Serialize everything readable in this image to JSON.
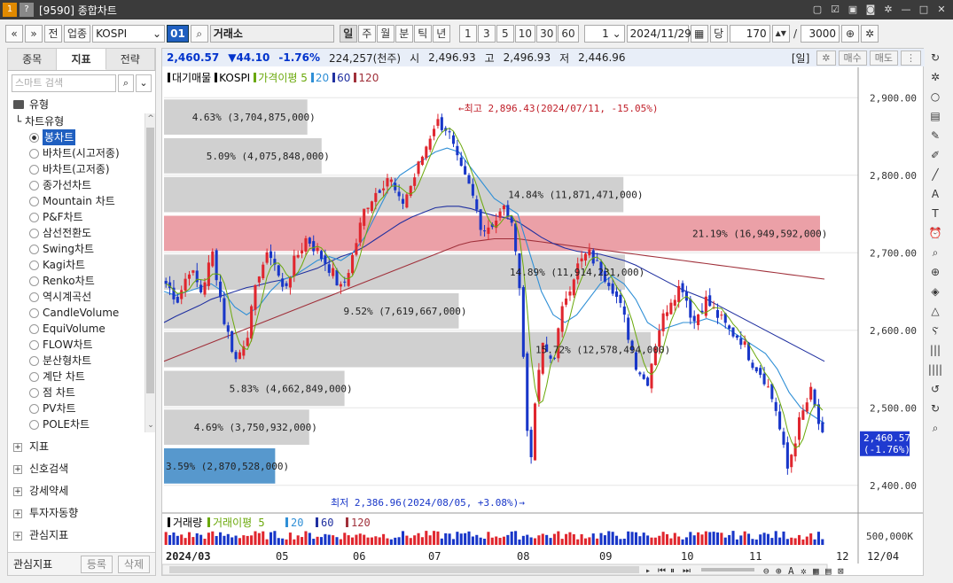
{
  "window": {
    "title": "[9590] 종합차트",
    "icons": [
      "app-icon",
      "help-icon"
    ]
  },
  "toolbar": {
    "jeon": "전",
    "sector": "업종",
    "symbol": "KOSPI",
    "code_btn": "01",
    "market": "거래소",
    "periods": [
      "일",
      "주",
      "월",
      "분",
      "틱",
      "년"
    ],
    "active_period": "일",
    "intervals": [
      "1",
      "3",
      "5",
      "10",
      "30",
      "60"
    ],
    "unit": "1",
    "date": "2024/11/29",
    "dang": "당",
    "count": "170",
    "slash": "/",
    "max": "3000"
  },
  "left": {
    "tabs": [
      "종목",
      "지표",
      "전략"
    ],
    "active_tab": "지표",
    "search_placeholder": "스마트 검색",
    "section": "유형",
    "tree_root": "차트유형",
    "items": [
      "봉차트",
      "바차트(시고저종)",
      "바차트(고저종)",
      "종가선차트",
      "Mountain 차트",
      "P&F차트",
      "삼선전환도",
      "Swing차트",
      "Kagi차트",
      "Renko차트",
      "역시계곡선",
      "CandleVolume",
      "EquiVolume",
      "FLOW차트",
      "분산형차트",
      "계단 차트",
      "점 차트",
      "PV차트",
      "POLE차트"
    ],
    "groups": [
      "지표",
      "신호검색",
      "강세약세",
      "투자자동향",
      "관심지표"
    ],
    "footer": {
      "label": "관심지표",
      "register": "등록",
      "delete": "삭제"
    }
  },
  "quote": {
    "price": "2,460.57",
    "change": "▼44.10",
    "rate": "-1.76%",
    "volume": "224,257(천주)",
    "open_label": "시",
    "open": "2,496.93",
    "high_label": "고",
    "high": "2,496.93",
    "low_label": "저",
    "low": "2,446.96",
    "period": "[일]",
    "buy": "매수",
    "sell": "매도"
  },
  "legend": [
    "대기매물",
    "KOSPI",
    "가격이평 5",
    "20",
    "60",
    "120"
  ],
  "colors": {
    "up": "#e0262e",
    "down": "#1836c8",
    "ma5": "#6aa80a",
    "ma20": "#2f8fd6",
    "ma60": "#2030a0",
    "ma120": "#a0303a",
    "vp": "#c8c8c8",
    "vp_hi": "#e88f98",
    "vp_cur": "#3a86c4"
  },
  "chart_data": {
    "type": "candlestick",
    "ylim": [
      2370,
      2930
    ],
    "y_ticks": [
      "2,900.00",
      "2,800.00",
      "2,700.00",
      "2,600.00",
      "2,500.00",
      "2,400.00"
    ],
    "y_tick_values": [
      2900,
      2800,
      2700,
      2600,
      2500,
      2400
    ],
    "x_labels": [
      "2024/03",
      "05",
      "06",
      "07",
      "08",
      "09",
      "10",
      "11",
      "12",
      "12/04"
    ],
    "last_price": "2,460.57",
    "last_rate": "(-1.76%)",
    "high_note": "←최고 2,896.43(2024/07/11, -15.05%)",
    "low_note": "최저 2,386.96(2024/08/05, +3.08%)→",
    "volume_profile": [
      {
        "label": "4.63% (3,704,875,000)",
        "pct": 4.63,
        "lo": 2850,
        "hi": 2900
      },
      {
        "label": "5.09% (4,075,848,000)",
        "pct": 5.09,
        "lo": 2800,
        "hi": 2850
      },
      {
        "label": "14.84% (11,871,471,000)",
        "pct": 14.84,
        "lo": 2750,
        "hi": 2800
      },
      {
        "label": "21.19% (16,949,592,000)",
        "pct": 21.19,
        "lo": 2700,
        "hi": 2750
      },
      {
        "label": "14.89% (11,914,231,000)",
        "pct": 14.89,
        "lo": 2650,
        "hi": 2700
      },
      {
        "label": "9.52% (7,619,667,000)",
        "pct": 9.52,
        "lo": 2600,
        "hi": 2650
      },
      {
        "label": "15.72% (12,578,494,000)",
        "pct": 15.72,
        "lo": 2550,
        "hi": 2600
      },
      {
        "label": "5.83% (4,662,849,000)",
        "pct": 5.83,
        "lo": 2500,
        "hi": 2550
      },
      {
        "label": "4.69% (3,750,932,000)",
        "pct": 4.69,
        "lo": 2450,
        "hi": 2500
      },
      {
        "label": "3.59% (2,870,528,000)",
        "pct": 3.59,
        "lo": 2400,
        "hi": 2450
      }
    ],
    "close_path": [
      2660,
      2640,
      2680,
      2650,
      2700,
      2610,
      2560,
      2600,
      2680,
      2700,
      2650,
      2690,
      2720,
      2700,
      2680,
      2650,
      2700,
      2760,
      2780,
      2800,
      2760,
      2790,
      2830,
      2870,
      2860,
      2810,
      2780,
      2730,
      2740,
      2760,
      2700,
      2420,
      2580,
      2560,
      2640,
      2680,
      2700,
      2680,
      2660,
      2620,
      2560,
      2530,
      2600,
      2640,
      2660,
      2610,
      2640,
      2620,
      2600,
      2590,
      2560,
      2540,
      2500,
      2420,
      2480,
      2520,
      2460
    ],
    "ma20_path": [
      2650,
      2645,
      2650,
      2655,
      2660,
      2650,
      2630,
      2620,
      2630,
      2650,
      2665,
      2670,
      2680,
      2690,
      2695,
      2690,
      2700,
      2720,
      2750,
      2780,
      2800,
      2810,
      2820,
      2830,
      2835,
      2830,
      2810,
      2790,
      2770,
      2760,
      2750,
      2700,
      2650,
      2620,
      2610,
      2620,
      2640,
      2660,
      2670,
      2660,
      2640,
      2610,
      2600,
      2605,
      2610,
      2610,
      2615,
      2610,
      2600,
      2590,
      2580,
      2570,
      2550,
      2520,
      2500,
      2490,
      2480
    ],
    "ma60_path": [
      2610,
      2618,
      2625,
      2632,
      2640,
      2645,
      2650,
      2655,
      2658,
      2662,
      2665,
      2670,
      2675,
      2680,
      2688,
      2695,
      2700,
      2708,
      2718,
      2728,
      2738,
      2746,
      2752,
      2758,
      2760,
      2760,
      2757,
      2752,
      2748,
      2745,
      2740,
      2730,
      2720,
      2712,
      2706,
      2702,
      2700,
      2698,
      2694,
      2690,
      2684,
      2676,
      2668,
      2660,
      2652,
      2646,
      2640,
      2632,
      2624,
      2616,
      2608,
      2600,
      2592,
      2584,
      2576,
      2568,
      2560
    ],
    "ma120_path": [
      2560,
      2566,
      2572,
      2578,
      2584,
      2590,
      2596,
      2602,
      2608,
      2614,
      2620,
      2626,
      2632,
      2638,
      2644,
      2650,
      2656,
      2662,
      2668,
      2674,
      2680,
      2686,
      2692,
      2698,
      2704,
      2710,
      2714,
      2716,
      2718,
      2718,
      2718,
      2716,
      2714,
      2712,
      2710,
      2708,
      2706,
      2704,
      2702,
      2700,
      2698,
      2696,
      2694,
      2692,
      2690,
      2688,
      2686,
      2684,
      2682,
      2680,
      2678,
      2676,
      2674,
      2672,
      2670,
      2668,
      2666
    ]
  },
  "volume_panel": {
    "legend": [
      "거래량",
      "거래이평 5",
      "20",
      "60",
      "120"
    ],
    "axis_label": "500,000K"
  },
  "right_tools": [
    "refresh-icon",
    "gear-icon",
    "circle-icon",
    "bar-chart-icon",
    "pen-icon",
    "pen2-icon",
    "line-icon",
    "auto-icon",
    "text-icon",
    "alarm-icon",
    "zoom-icon",
    "zoom-in-icon",
    "layers-icon",
    "triangle-icon",
    "zigzag-icon",
    "bars-icon",
    "bars2-icon",
    "undo-icon",
    "redo-icon",
    "search-icon"
  ]
}
